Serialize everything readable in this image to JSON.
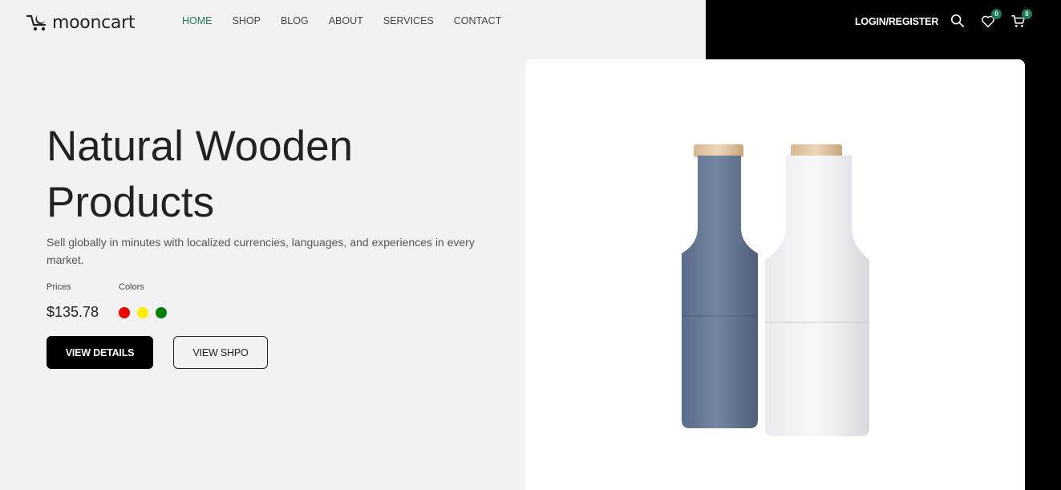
{
  "brand": {
    "name": "mooncart",
    "logo_icon": "cart-moon-icon"
  },
  "nav": {
    "items": [
      {
        "label": "HOME",
        "active": true
      },
      {
        "label": "SHOP",
        "active": false
      },
      {
        "label": "BLOG",
        "active": false
      },
      {
        "label": "ABOUT",
        "active": false
      },
      {
        "label": "SERVICES",
        "active": false
      },
      {
        "label": "CONTACT",
        "active": false
      }
    ]
  },
  "header": {
    "login_label": "LOGIN/REGISTER",
    "icons": [
      "search-icon",
      "heart-icon",
      "cart-icon"
    ],
    "wishlist_count": "0",
    "cart_count": "0"
  },
  "hero": {
    "title_line1": "Natural Wooden",
    "title_line2": "Products",
    "description": "Sell globally in minutes with localized currencies, languages, and experiences in every market.",
    "prices_label": "Prices",
    "price": "$135.78",
    "colors_label": "Colors",
    "colors": [
      "#ee0000",
      "#ffee00",
      "#008000"
    ],
    "primary_button": "VIEW DETAILS",
    "secondary_button": "VIEW SHPO"
  },
  "product": {
    "image": "grinder-bottles"
  },
  "theme": {
    "accent": "#1a7a5a",
    "dark": "#000000",
    "background": "#f2f2f2"
  }
}
